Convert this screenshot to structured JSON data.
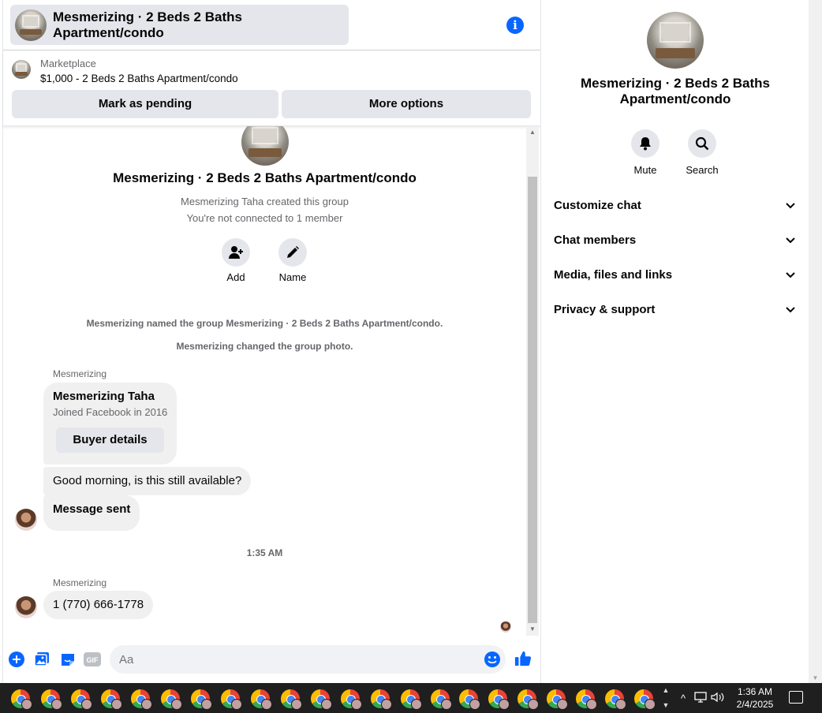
{
  "chat": {
    "title": "Mesmerizing · 2 Beds 2 Baths Apartment/condo",
    "listing": {
      "source": "Marketplace",
      "price_title": "$1,000 - 2 Beds 2 Baths Apartment/condo",
      "pending_label": "Mark as pending",
      "more_label": "More options"
    },
    "intro": {
      "group_name": "Mesmerizing · 2 Beds 2 Baths Apartment/condo",
      "created": "Mesmerizing Taha created this group",
      "connection": "You're not connected to 1 member",
      "add_label": "Add",
      "name_label": "Name"
    },
    "system_messages": [
      "Mesmerizing named the group Mesmerizing · 2 Beds 2 Baths Apartment/condo.",
      "Mesmerizing changed the group photo."
    ],
    "messages": {
      "sender1": "Mesmerizing",
      "card_name": "Mesmerizing Taha",
      "card_joined": "Joined Facebook in 2016",
      "card_button": "Buyer details",
      "msg1": "Good morning, is this still available?",
      "msg2": "Message sent",
      "timestamp": "1:35 AM",
      "sender2": "Mesmerizing",
      "msg3": "1 (770) 666-1778"
    },
    "composer": {
      "placeholder": "Aa",
      "gif_label": "GIF"
    }
  },
  "info": {
    "title": "Mesmerizing · 2 Beds 2 Baths Apartment/condo",
    "mute_label": "Mute",
    "search_label": "Search",
    "sections": [
      "Customize chat",
      "Chat members",
      "Media, files and links",
      "Privacy & support"
    ]
  },
  "taskbar": {
    "time": "1:36 AM",
    "date": "2/4/2025"
  },
  "colors": {
    "accent": "#0866ff",
    "bubble": "#f0f0f0",
    "button": "#e4e6eb"
  }
}
